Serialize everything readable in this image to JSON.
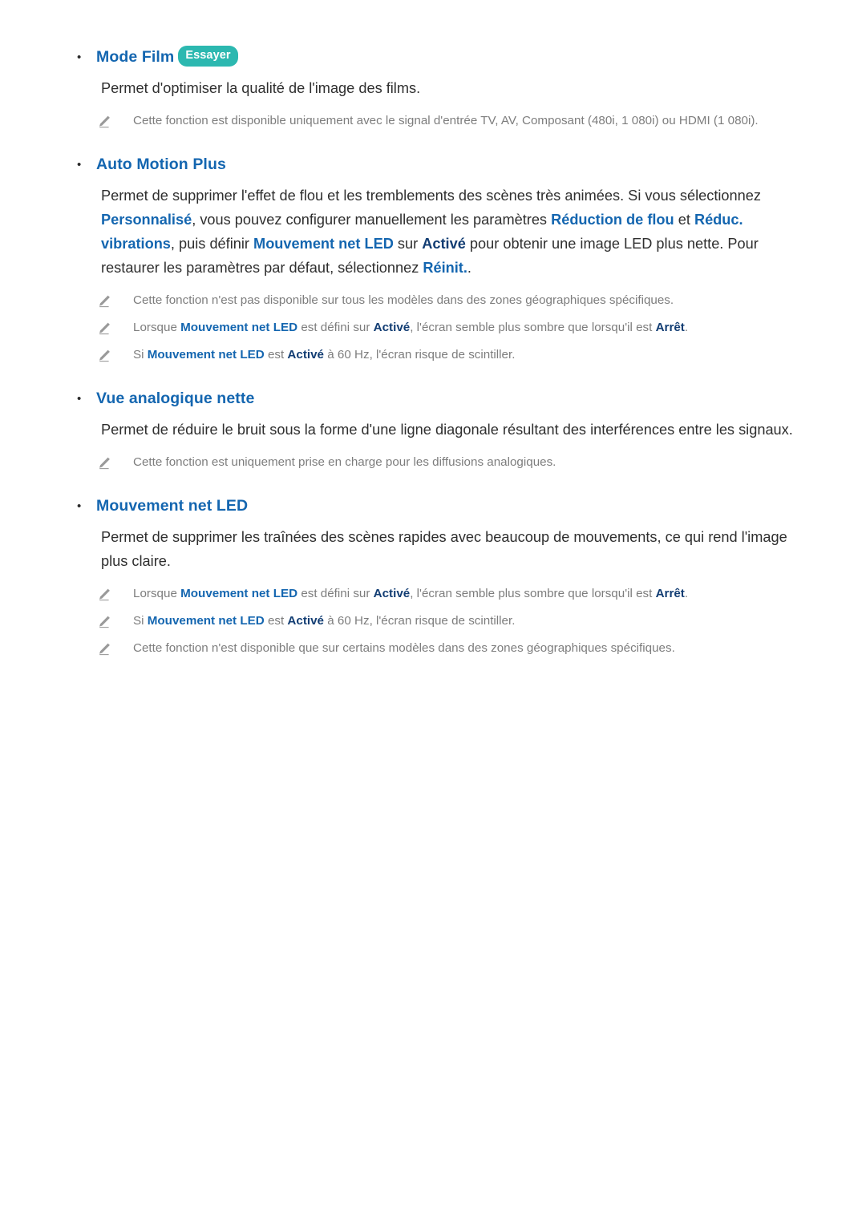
{
  "page": {
    "background": "#ffffff",
    "heading_color": "#1466b0",
    "badge_color": "#2cb8b0",
    "note_color": "#7d7d7d",
    "body_color": "#2f2f2f"
  },
  "bullet_glyph": "•",
  "sections": [
    {
      "id": "mode-film",
      "heading": "Mode Film",
      "badge": "Essayer",
      "paragraph": {
        "parts": [
          {
            "text": "Permet d'optimiser la qualité de l'image des films.",
            "style": "normal"
          }
        ]
      },
      "notes": [
        {
          "icon": "pencil-icon",
          "parts": [
            {
              "text": "Cette fonction est disponible uniquement avec le signal d'entrée TV, AV, Composant (480i, 1 080i) ou HDMI (1 080i).",
              "style": "normal"
            }
          ]
        }
      ]
    },
    {
      "id": "auto-motion-plus",
      "heading": "Auto Motion Plus",
      "badge": null,
      "paragraph": {
        "parts": [
          {
            "text": "Permet de supprimer l'effet de flou et les tremblements des scènes très animées. Si vous sélectionnez ",
            "style": "normal"
          },
          {
            "text": "Personnalisé",
            "style": "blue"
          },
          {
            "text": ", vous pouvez configurer manuellement les paramètres ",
            "style": "normal"
          },
          {
            "text": "Réduction de flou",
            "style": "blue"
          },
          {
            "text": " et ",
            "style": "normal"
          },
          {
            "text": "Réduc. vibrations",
            "style": "blue"
          },
          {
            "text": ", puis définir ",
            "style": "normal"
          },
          {
            "text": "Mouvement net LED",
            "style": "blue"
          },
          {
            "text": " sur ",
            "style": "normal"
          },
          {
            "text": "Activé",
            "style": "navy"
          },
          {
            "text": " pour obtenir une image LED plus nette. Pour restaurer les paramètres par défaut, sélectionnez ",
            "style": "normal"
          },
          {
            "text": "Réinit.",
            "style": "blue"
          },
          {
            "text": ".",
            "style": "normal"
          }
        ]
      },
      "notes": [
        {
          "icon": "pencil-icon",
          "parts": [
            {
              "text": "Cette fonction n'est pas disponible sur tous les modèles dans des zones géographiques spécifiques.",
              "style": "normal"
            }
          ]
        },
        {
          "icon": "pencil-icon",
          "parts": [
            {
              "text": "Lorsque ",
              "style": "normal"
            },
            {
              "text": "Mouvement net LED",
              "style": "blue"
            },
            {
              "text": " est défini sur ",
              "style": "normal"
            },
            {
              "text": "Activé",
              "style": "navy"
            },
            {
              "text": ", l'écran semble plus sombre que lorsqu'il est ",
              "style": "normal"
            },
            {
              "text": "Arrêt",
              "style": "navy"
            },
            {
              "text": ".",
              "style": "normal"
            }
          ]
        },
        {
          "icon": "pencil-icon",
          "parts": [
            {
              "text": "Si ",
              "style": "normal"
            },
            {
              "text": "Mouvement net LED",
              "style": "blue"
            },
            {
              "text": " est ",
              "style": "normal"
            },
            {
              "text": "Activé",
              "style": "navy"
            },
            {
              "text": " à 60 Hz, l'écran risque de scintiller.",
              "style": "normal"
            }
          ]
        }
      ]
    },
    {
      "id": "vue-analogique-nette",
      "heading": "Vue analogique nette",
      "badge": null,
      "paragraph": {
        "parts": [
          {
            "text": "Permet de réduire le bruit sous la forme d'une ligne diagonale résultant des interférences entre les signaux.",
            "style": "normal"
          }
        ]
      },
      "notes": [
        {
          "icon": "pencil-icon",
          "parts": [
            {
              "text": "Cette fonction est uniquement prise en charge pour les diffusions analogiques.",
              "style": "normal"
            }
          ]
        }
      ]
    },
    {
      "id": "mouvement-net-led",
      "heading": "Mouvement net LED",
      "badge": null,
      "paragraph": {
        "parts": [
          {
            "text": "Permet de supprimer les traînées des scènes rapides avec beaucoup de mouvements, ce qui rend l'image plus claire.",
            "style": "normal"
          }
        ]
      },
      "notes": [
        {
          "icon": "pencil-icon",
          "parts": [
            {
              "text": "Lorsque ",
              "style": "normal"
            },
            {
              "text": "Mouvement net LED",
              "style": "blue"
            },
            {
              "text": " est défini sur ",
              "style": "normal"
            },
            {
              "text": "Activé",
              "style": "navy"
            },
            {
              "text": ", l'écran semble plus sombre que lorsqu'il est ",
              "style": "normal"
            },
            {
              "text": "Arrêt",
              "style": "navy"
            },
            {
              "text": ".",
              "style": "normal"
            }
          ]
        },
        {
          "icon": "pencil-icon",
          "parts": [
            {
              "text": "Si ",
              "style": "normal"
            },
            {
              "text": "Mouvement net LED",
              "style": "blue"
            },
            {
              "text": " est ",
              "style": "normal"
            },
            {
              "text": "Activé",
              "style": "navy"
            },
            {
              "text": " à 60 Hz, l'écran risque de scintiller.",
              "style": "normal"
            }
          ]
        },
        {
          "icon": "pencil-icon",
          "parts": [
            {
              "text": "Cette fonction n'est disponible que sur certains modèles dans des zones géographiques spécifiques.",
              "style": "normal"
            }
          ]
        }
      ]
    }
  ]
}
